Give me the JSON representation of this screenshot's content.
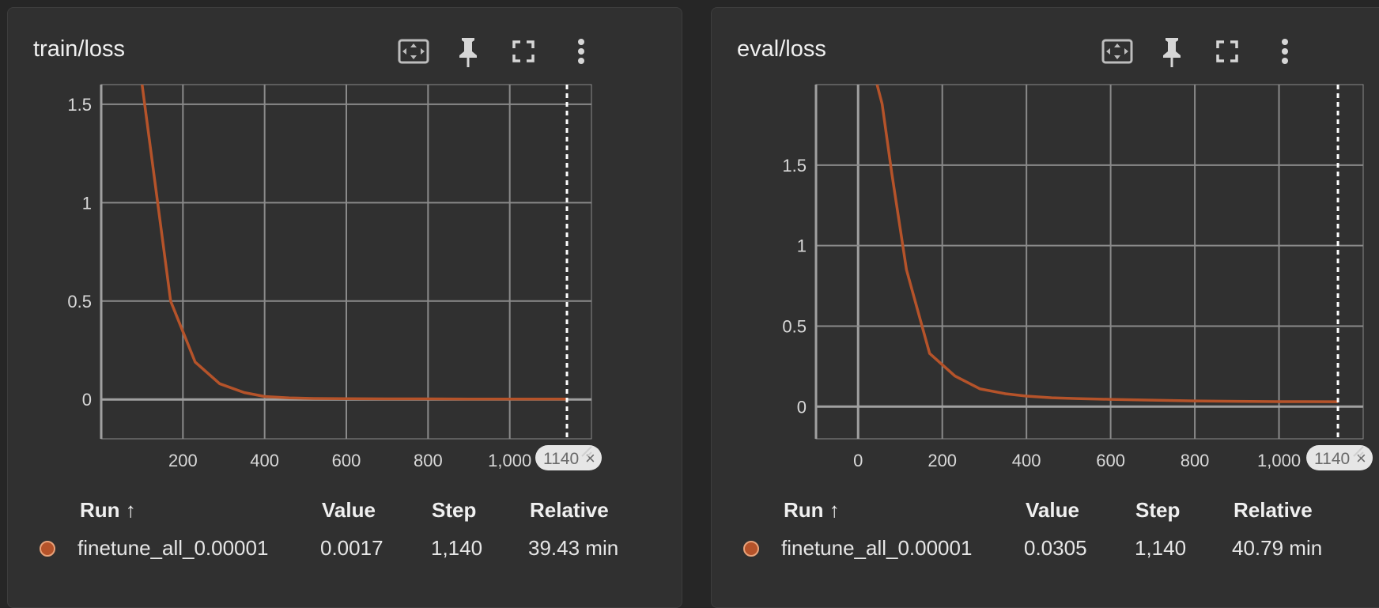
{
  "colors": {
    "series": "#b5532a",
    "background": "#303030",
    "grid": "#8a8a8a"
  },
  "panels": [
    {
      "title": "train/loss",
      "icons": [
        "fit-domain-icon",
        "pin-icon",
        "fullscreen-icon",
        "more-vert-icon"
      ],
      "cursor_label": "1140",
      "table": {
        "headers": {
          "run": "Run ↑",
          "value": "Value",
          "step": "Step",
          "relative": "Relative"
        },
        "row": {
          "run": "finetune_all_0.00001",
          "value": "0.0017",
          "step": "1,140",
          "relative": "39.43 min"
        }
      }
    },
    {
      "title": "eval/loss",
      "icons": [
        "fit-domain-icon",
        "pin-icon",
        "fullscreen-icon",
        "more-vert-icon"
      ],
      "cursor_label": "1140",
      "table": {
        "headers": {
          "run": "Run ↑",
          "value": "Value",
          "step": "Step",
          "relative": "Relative"
        },
        "row": {
          "run": "finetune_all_0.00001",
          "value": "0.0305",
          "step": "1,140",
          "relative": "40.79 min"
        }
      }
    }
  ],
  "chart_data": [
    {
      "type": "line",
      "title": "train/loss",
      "xlim": [
        0,
        1200
      ],
      "ylim": [
        -0.2,
        1.6
      ],
      "x_ticks": [
        200,
        400,
        600,
        800,
        1000
      ],
      "x_tick_labels": [
        "200",
        "400",
        "600",
        "800",
        "1,000"
      ],
      "y_ticks": [
        0,
        0.5,
        1,
        1.5
      ],
      "y_tick_labels": [
        "0",
        "0.5",
        "1",
        "1.5"
      ],
      "cursor_x": 1140,
      "grid": true,
      "series": [
        {
          "x": [
            100,
            170,
            230,
            290,
            350,
            400,
            460,
            520,
            600,
            700,
            800,
            900,
            1000,
            1100,
            1140
          ],
          "y": [
            1.6,
            0.5,
            0.19,
            0.08,
            0.035,
            0.015,
            0.008,
            0.005,
            0.004,
            0.003,
            0.003,
            0.002,
            0.002,
            0.0017,
            0.0017
          ]
        }
      ]
    },
    {
      "type": "line",
      "title": "eval/loss",
      "xlim": [
        -100,
        1200
      ],
      "ylim": [
        -0.2,
        2.0
      ],
      "x_ticks": [
        0,
        200,
        400,
        600,
        800,
        1000
      ],
      "x_tick_labels": [
        "0",
        "200",
        "400",
        "600",
        "800",
        "1,000"
      ],
      "y_ticks": [
        0,
        0.5,
        1,
        1.5
      ],
      "y_tick_labels": [
        "0",
        "0.5",
        "1",
        "1.5"
      ],
      "cursor_x": 1140,
      "grid": true,
      "series": [
        {
          "x": [
            45,
            57,
            80,
            115,
            170,
            230,
            290,
            350,
            400,
            460,
            520,
            600,
            700,
            800,
            900,
            1000,
            1140
          ],
          "y": [
            2.0,
            1.88,
            1.45,
            0.85,
            0.33,
            0.19,
            0.11,
            0.08,
            0.065,
            0.055,
            0.05,
            0.045,
            0.04,
            0.035,
            0.033,
            0.031,
            0.0305
          ]
        }
      ]
    }
  ]
}
